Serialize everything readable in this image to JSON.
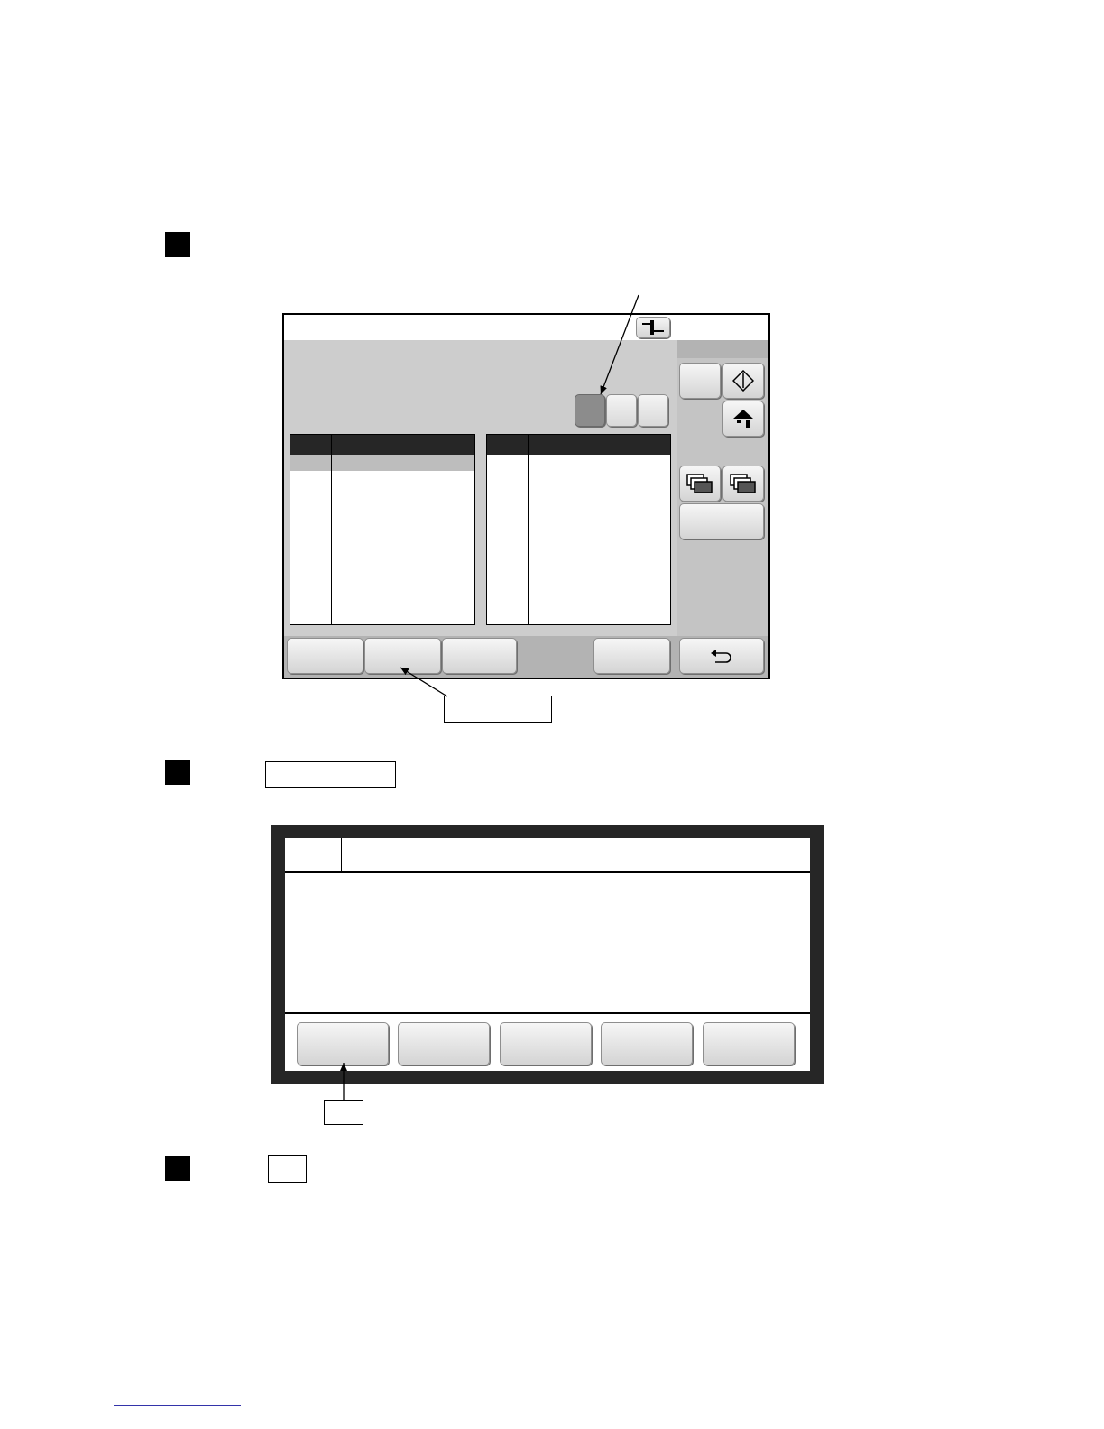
{
  "document": {
    "steps": [
      {
        "marker": ""
      },
      {
        "marker": ""
      },
      {
        "marker": ""
      }
    ]
  },
  "screen1": {
    "title_icon": "split-view-icon",
    "tabs": [
      "",
      "",
      ""
    ],
    "active_tab": 0,
    "side_icons": [
      "start-diamond-icon",
      "home-icon",
      "stack-pages-icon",
      "stack-pages-icon"
    ],
    "bottom_icon": "return-arrow-icon",
    "callouts": {
      "tabs": "",
      "bottom_button": ""
    }
  },
  "screen2": {
    "buttons": [
      "",
      "",
      "",
      "",
      ""
    ],
    "callout": ""
  },
  "step_labels": {
    "step2": "",
    "step3": ""
  },
  "colors": {
    "screen_bg": "#b3b3b3",
    "header": "#262626",
    "active_tab": "#8c8c8c"
  }
}
